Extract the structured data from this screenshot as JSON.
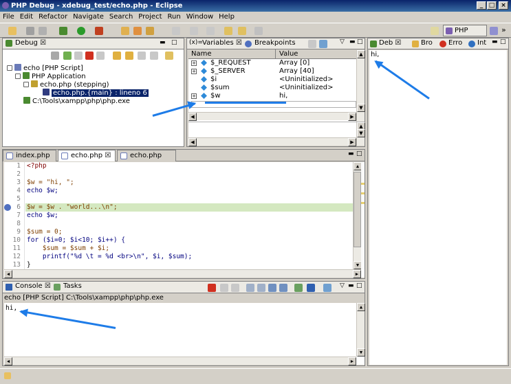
{
  "window": {
    "title": "PHP Debug - xdebug_test/echo.php - Eclipse",
    "min": "_",
    "max": "□",
    "close": "×"
  },
  "menu": [
    "File",
    "Edit",
    "Refactor",
    "Navigate",
    "Search",
    "Project",
    "Run",
    "Window",
    "Help"
  ],
  "perspective": {
    "label": "PHP Debug",
    "more": "»"
  },
  "debug_view": {
    "tab": "Debug ☒",
    "tree": [
      {
        "label": "echo [PHP Script]",
        "icon": "php-script-icon"
      },
      {
        "label": "PHP Application",
        "icon": "php-app-icon"
      },
      {
        "label": "echo.php (stepping)",
        "icon": "thread-icon"
      },
      {
        "label": "echo.php.{main} : lineno 6",
        "icon": "stack-frame-icon"
      },
      {
        "label": "C:\\Tools\\xampp\\php\\php.exe",
        "icon": "process-icon"
      }
    ]
  },
  "variables_view": {
    "tab": "Variables ☒",
    "tab2": "Breakpoints",
    "col_name": "Name",
    "col_value": "Value",
    "rows": [
      {
        "name": "$_REQUEST",
        "value": "Array [0]"
      },
      {
        "name": "$_SERVER",
        "value": "Array [40]"
      },
      {
        "name": "$i",
        "value": "<Uninitialized>"
      },
      {
        "name": "$sum",
        "value": "<Uninitialized>"
      },
      {
        "name": "$w",
        "value": "hi,"
      }
    ]
  },
  "browser_view": {
    "tabs": [
      "Deb ☒",
      "Bro",
      "Erro",
      "Int"
    ],
    "output": "hi,"
  },
  "editor": {
    "tabs": [
      "index.php",
      "echo.php ☒",
      "echo.php"
    ],
    "lines": [
      {
        "n": "1",
        "code": "<?php"
      },
      {
        "n": "2",
        "code": ""
      },
      {
        "n": "3",
        "code": "$w = \"hi, \";"
      },
      {
        "n": "4",
        "code": "echo $w;"
      },
      {
        "n": "5",
        "code": ""
      },
      {
        "n": "6",
        "code": "$w = $w . \"world...\\n\";"
      },
      {
        "n": "7",
        "code": "echo $w;"
      },
      {
        "n": "8",
        "code": ""
      },
      {
        "n": "9",
        "code": "$sum = 0;"
      },
      {
        "n": "10",
        "code": "for ($i=0; $i<10; $i++) {"
      },
      {
        "n": "11",
        "code": "    $sum = $sum + $i;"
      },
      {
        "n": "12",
        "code": "    printf(\"%d \\t = %d <br>\\n\", $i, $sum);"
      },
      {
        "n": "13",
        "code": "}"
      }
    ]
  },
  "console": {
    "tabs": [
      "Console ☒",
      "Tasks"
    ],
    "header": "echo [PHP Script] C:\\Tools\\xampp\\php\\php.exe",
    "output": "hi,"
  },
  "colors": {
    "arrow": "#1e7ce8",
    "selection": "#0a246a",
    "current_line": "#d4e8c0"
  }
}
